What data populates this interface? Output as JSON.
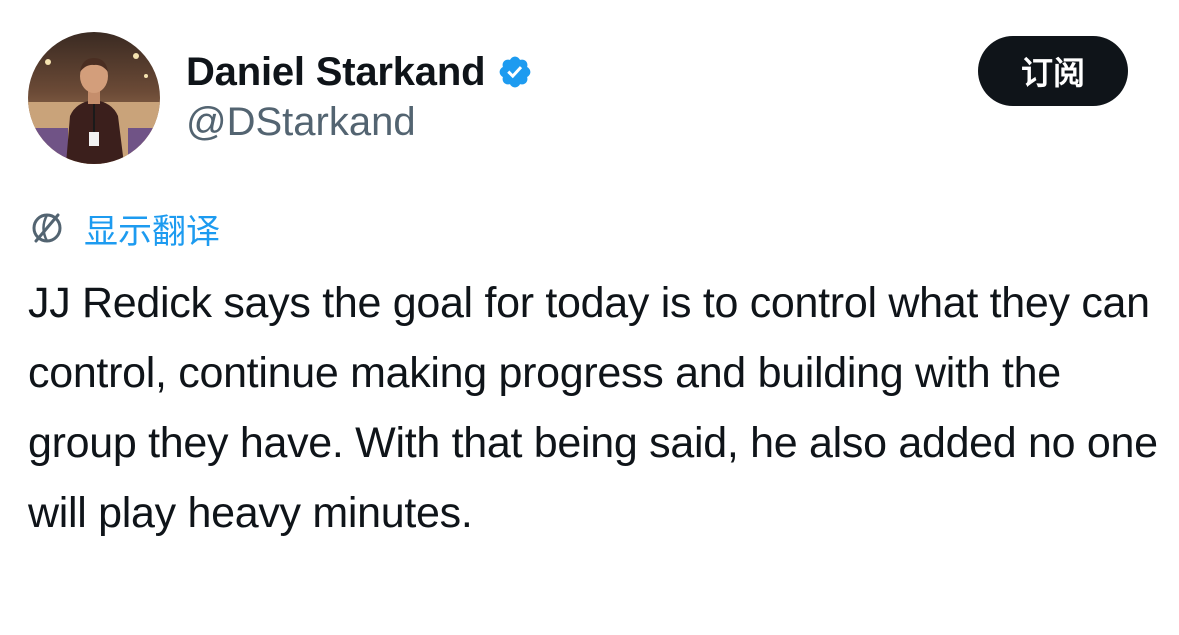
{
  "author": {
    "display_name": "Daniel Starkand",
    "handle": "@DStarkand",
    "verified": true,
    "avatar_icon": "profile-photo"
  },
  "header": {
    "subscribe_label": "订阅"
  },
  "translate": {
    "icon": "translate-globe-icon",
    "label": "显示翻译"
  },
  "tweet": {
    "text": "JJ Redick says the goal for today is to control what they can control, continue making progress and building with the group they have. With that being said, he also added no one will play heavy minutes."
  },
  "colors": {
    "accent": "#1d9bf0",
    "text": "#0f1419",
    "secondary": "#536471",
    "button_bg": "#0f1419",
    "button_text": "#ffffff"
  }
}
